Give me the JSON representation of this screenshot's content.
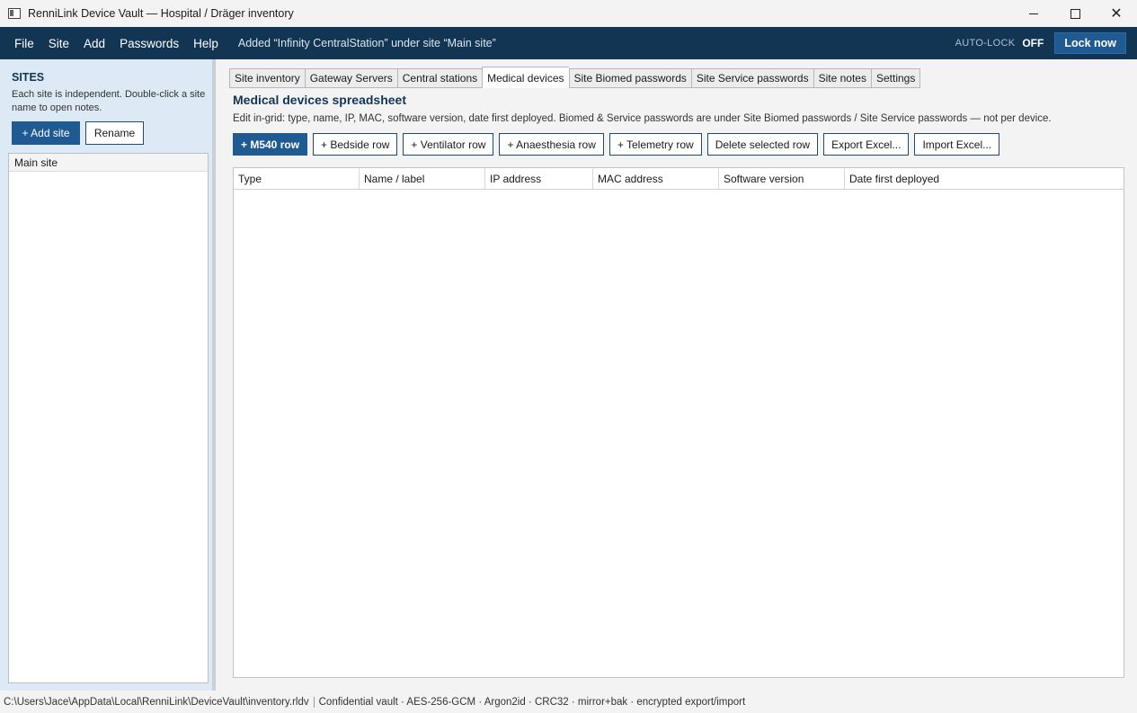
{
  "window": {
    "title": "RenniLink Device Vault — Hospital / Dräger inventory",
    "icon": "app-window-icon"
  },
  "menubar": {
    "items": [
      "File",
      "Site",
      "Add",
      "Passwords",
      "Help"
    ],
    "status": "Added “Infinity CentralStation” under site “Main site”",
    "autolock_label": "AUTO-LOCK",
    "autolock_value": "OFF",
    "lock_button": "Lock now"
  },
  "sidebar": {
    "heading": "SITES",
    "help": "Each site is independent. Double-click a site name to open notes.",
    "add_button": "+ Add site",
    "rename_button": "Rename",
    "sites": [
      "Main site"
    ]
  },
  "main": {
    "tabs": [
      {
        "label": "Site inventory",
        "active": false
      },
      {
        "label": "Gateway Servers",
        "active": false
      },
      {
        "label": "Central stations",
        "active": false
      },
      {
        "label": "Medical devices",
        "active": true
      },
      {
        "label": "Site Biomed passwords",
        "active": false
      },
      {
        "label": "Site Service passwords",
        "active": false
      },
      {
        "label": "Site notes",
        "active": false
      },
      {
        "label": "Settings",
        "active": false
      }
    ],
    "title": "Medical devices spreadsheet",
    "description": "Edit in-grid: type, name, IP, MAC, software version, date first deployed. Biomed & Service passwords are under Site Biomed passwords / Site Service passwords — not per device.",
    "actions": {
      "m540": "+ M540 row",
      "bedside": "+ Bedside row",
      "ventilator": "+ Ventilator row",
      "anaesthesia": "+ Anaesthesia row",
      "telemetry": "+ Telemetry row",
      "delete": "Delete selected row",
      "export": "Export Excel...",
      "import": "Import Excel..."
    },
    "grid": {
      "columns": [
        "Type",
        "Name / label",
        "IP address",
        "MAC address",
        "Software version",
        "Date first deployed"
      ],
      "rows": []
    }
  },
  "statusbar": {
    "path": "C:\\Users\\Jace\\AppData\\Local\\RenniLink\\DeviceVault\\inventory.rldv",
    "info": "Confidential vault · AES-256-GCM · Argon2id · CRC32 · mirror+bak · encrypted export/import"
  },
  "colors": {
    "menubar_bg": "#123554",
    "primary_button": "#1f5a92",
    "sidebar_bg": "#dde9f5",
    "heading": "#123554"
  }
}
